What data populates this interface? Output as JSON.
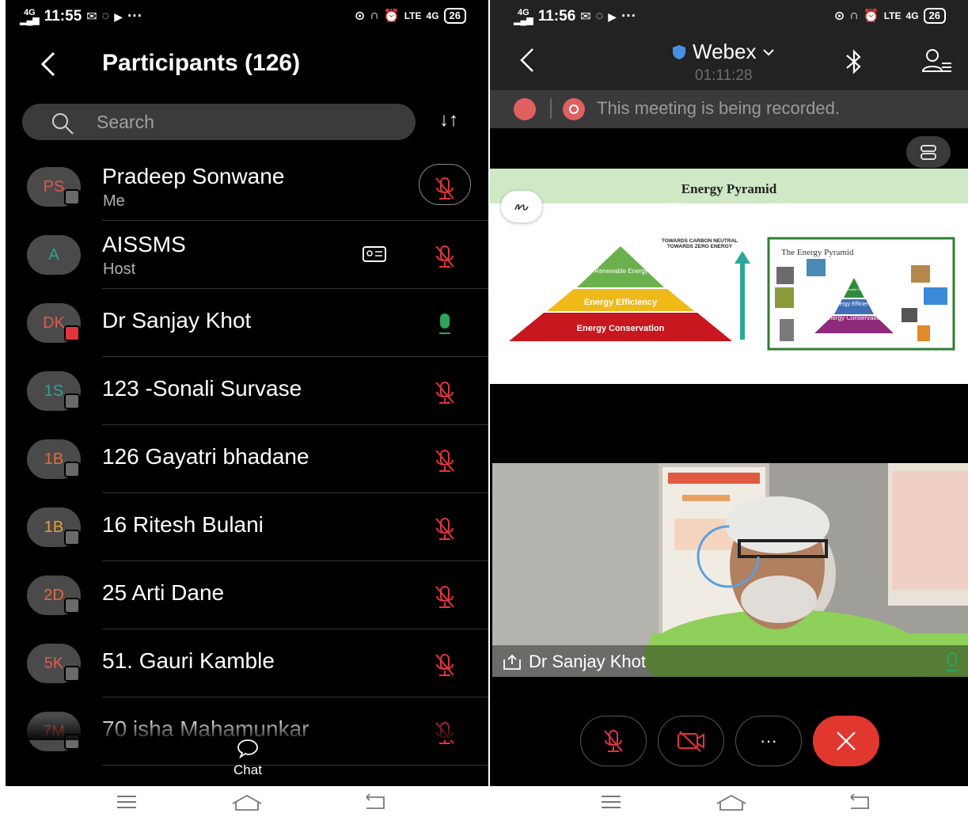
{
  "left_screen": {
    "status": {
      "time": "11:55",
      "network": "4G",
      "data_speed": "",
      "battery": "26"
    },
    "header": {
      "title": "Participants (126)"
    },
    "search": {
      "placeholder": "Search"
    },
    "sort_icon": "sort-arrows-icon",
    "participants": [
      {
        "initials": "PS",
        "name": "Pradeep Sonwane",
        "role": "Me",
        "mic": "muted",
        "initials_color": "#e05a4f"
      },
      {
        "initials": "A",
        "name": "AISSMS",
        "role": "Host",
        "mic": "muted",
        "initials_color": "#2ea58f"
      },
      {
        "initials": "DK",
        "name": "Dr Sanjay Khot",
        "role": "",
        "mic": "active",
        "initials_color": "#e05a4f"
      },
      {
        "initials": "1S",
        "name": "123 -Sonali Survase",
        "role": "",
        "mic": "muted",
        "initials_color": "#2ea58f"
      },
      {
        "initials": "1B",
        "name": "126 Gayatri bhadane",
        "role": "",
        "mic": "muted",
        "initials_color": "#e86a3a"
      },
      {
        "initials": "1B",
        "name": "16 Ritesh Bulani",
        "role": "",
        "mic": "muted",
        "initials_color": "#e8a03a"
      },
      {
        "initials": "2D",
        "name": "25 Arti Dane",
        "role": "",
        "mic": "muted",
        "initials_color": "#e86a3a"
      },
      {
        "initials": "5K",
        "name": "51. Gauri Kamble",
        "role": "",
        "mic": "muted",
        "initials_color": "#e05a4f"
      },
      {
        "initials": "7M",
        "name": "70 isha Mahamunkar",
        "role": "",
        "mic": "muted",
        "initials_color": "#e05a4f"
      }
    ],
    "chat_label": "Chat"
  },
  "right_screen": {
    "status": {
      "time": "11:56",
      "network": "4G",
      "battery": "26"
    },
    "meeting_title": "Webex",
    "timer": "01:11:28",
    "recording_text": "This meeting is being recorded.",
    "slide": {
      "title": "Energy Pyramid",
      "note_top": "TOWARDS CARBON NEUTRAL",
      "note_bottom": "TOWARDS ZERO ENERGY",
      "tiers": [
        "Renewable Energy",
        "Energy Efficiency",
        "Energy Conservation"
      ],
      "inset_title": "The Energy Pyramid",
      "inset_tiers": [
        "Renewable Energy",
        "Energy Efficiency",
        "Energy Conservation"
      ]
    },
    "active_speaker": "Dr Sanjay Khot"
  },
  "colors": {
    "muted_red": "#e0353b",
    "active_green": "#2ea55a",
    "end_call": "#e0382e"
  }
}
